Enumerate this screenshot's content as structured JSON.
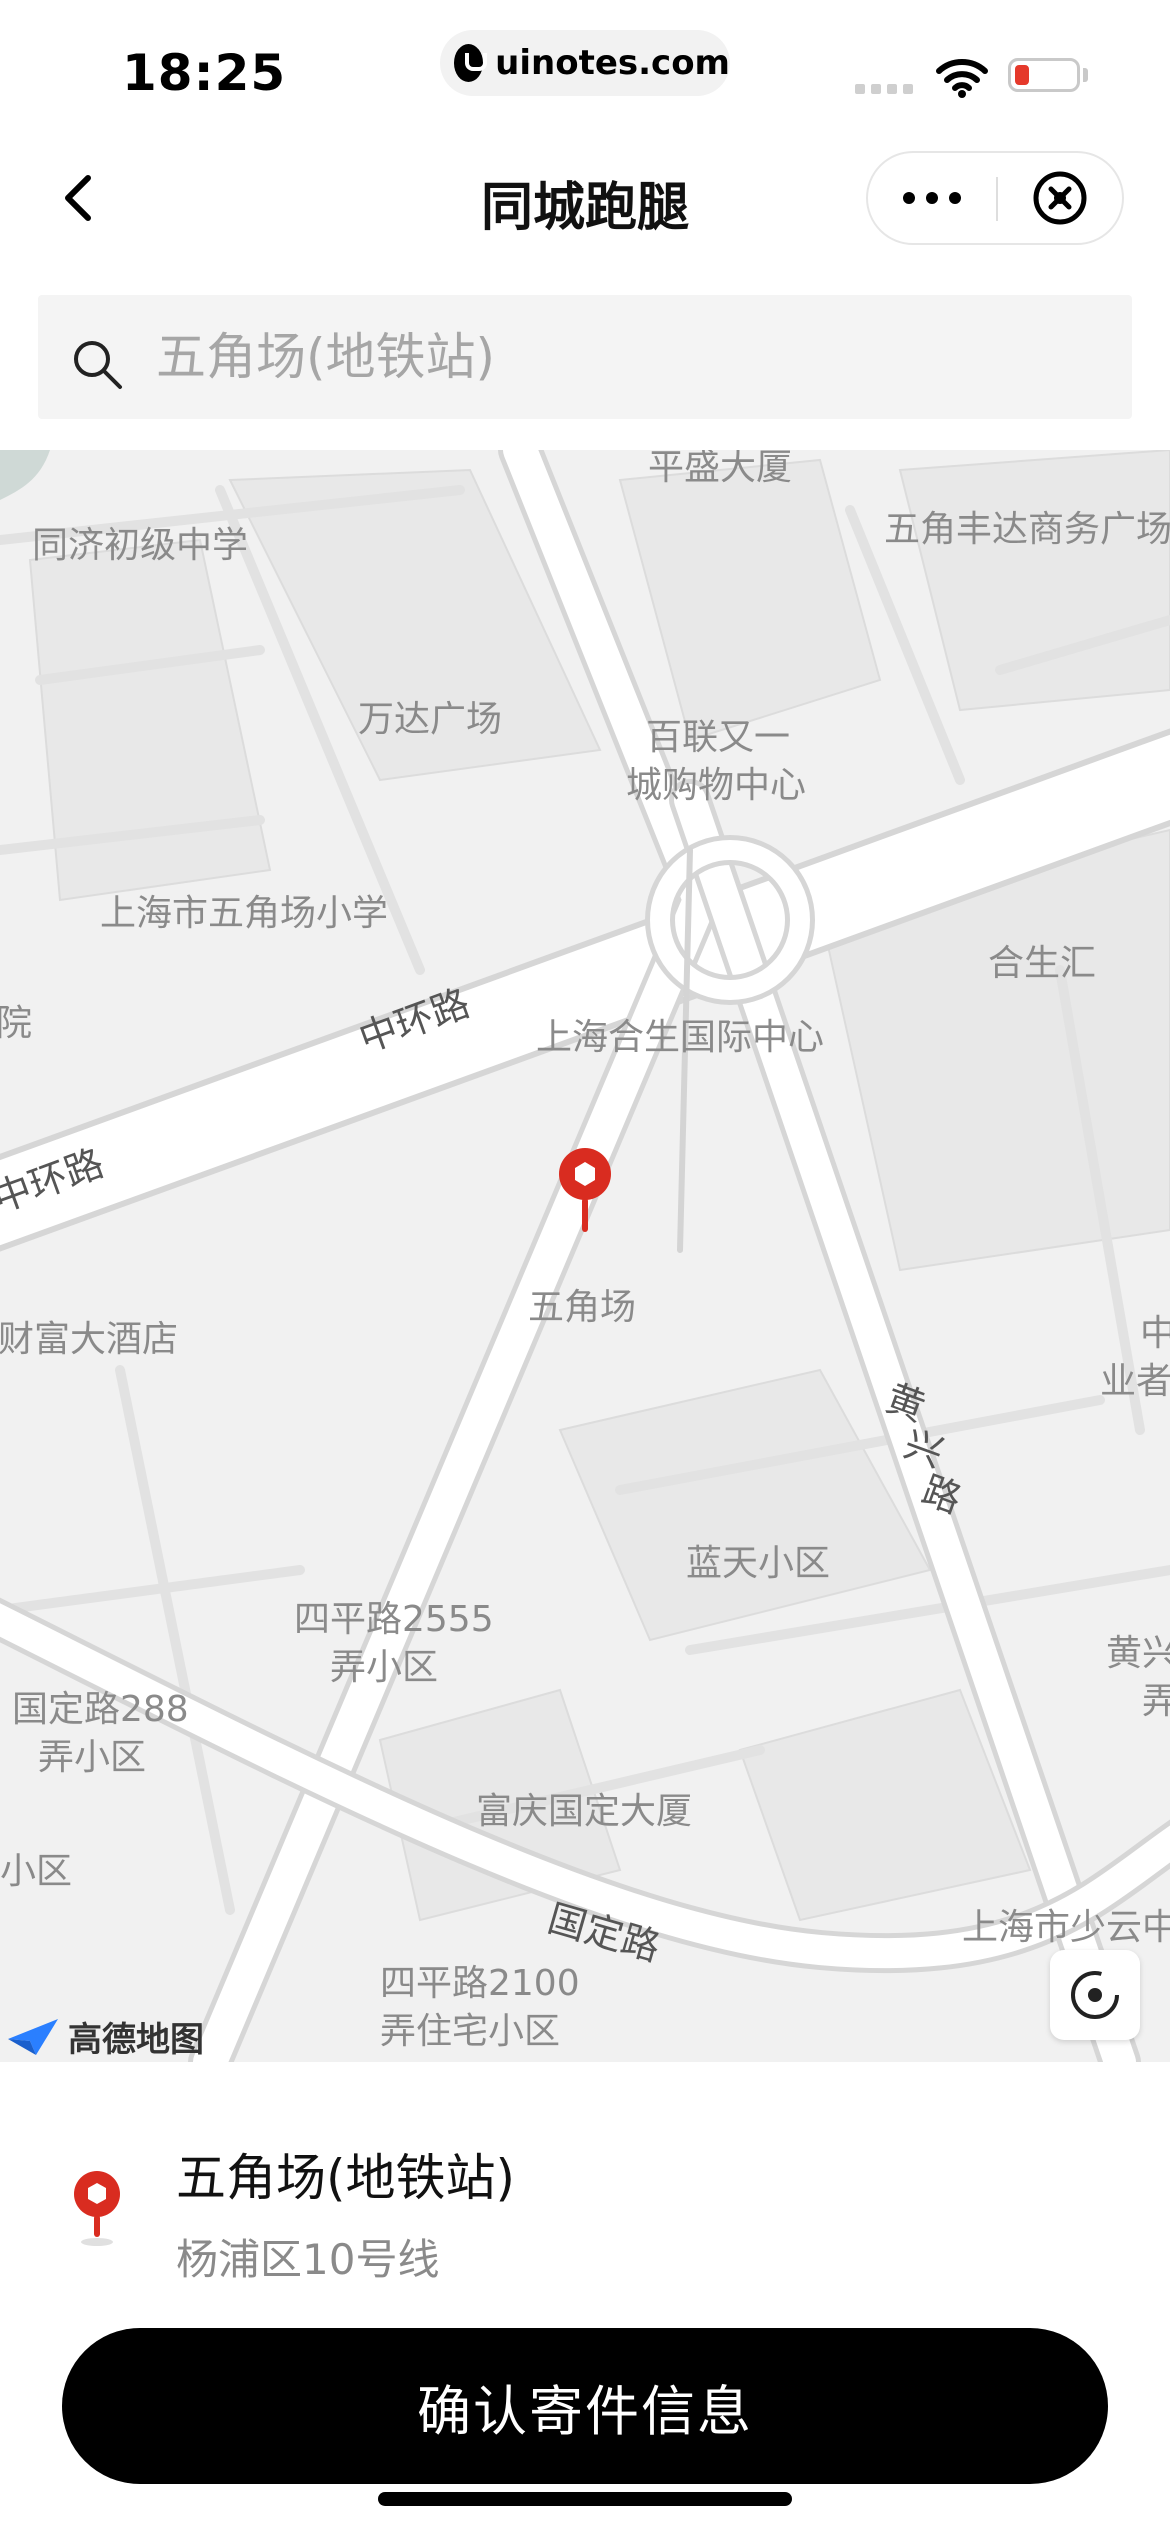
{
  "status_bar": {
    "time": "18:25",
    "url": "uinotes.com",
    "battery_color": "#e5392b"
  },
  "nav": {
    "title": "同城跑腿",
    "back_icon": "chevron-left-icon",
    "more_icon": "more-dots-icon",
    "close_icon": "close-circle-icon"
  },
  "search": {
    "placeholder": "五角场(地铁站)",
    "value": ""
  },
  "map": {
    "labels": {
      "pingsheng": "平盛大厦",
      "tongji": "同济初级中学",
      "fengda": "五角丰达商务广场",
      "wanda": "万达广场",
      "bailian_1": "百联又一",
      "bailian_2": "城购物中心",
      "xiaoxue": "上海市五角场小学",
      "hesheng_hui": "合生汇",
      "yuan": "院",
      "hesheng_center": "上海合生国际中心",
      "wujiaochang": "五角场",
      "caifu": "财富大酒店",
      "zhong": "中",
      "yezhe": "业者",
      "lantian": "蓝天小区",
      "siping2555_1": "四平路2555",
      "siping2555_2": "弄小区",
      "huangxing_r": "黄兴",
      "nong": "弄",
      "guoding288_1": "国定路288",
      "guoding288_2": "弄小区",
      "xiaoqu": "小区",
      "fuqing": "富庆国定大厦",
      "shaoyun": "上海市少云中",
      "siping2100_1": "四平路2100",
      "siping2100_2": "弄住宅小区"
    },
    "roads": {
      "zhonghuan_1": "中环路",
      "zhonghuan_2": "中环路",
      "huangxing_1": "黄",
      "huangxing_2": "兴",
      "huangxing_3": "路",
      "guoding": "国定路"
    },
    "attribution": "高德地图",
    "pin_color": "#d92c20",
    "locate_icon": "locate-icon"
  },
  "result": {
    "name": "五角场(地铁站)",
    "address": "杨浦区10号线",
    "pin_icon": "location-pin-icon"
  },
  "confirm": {
    "label": "确认寄件信息"
  }
}
